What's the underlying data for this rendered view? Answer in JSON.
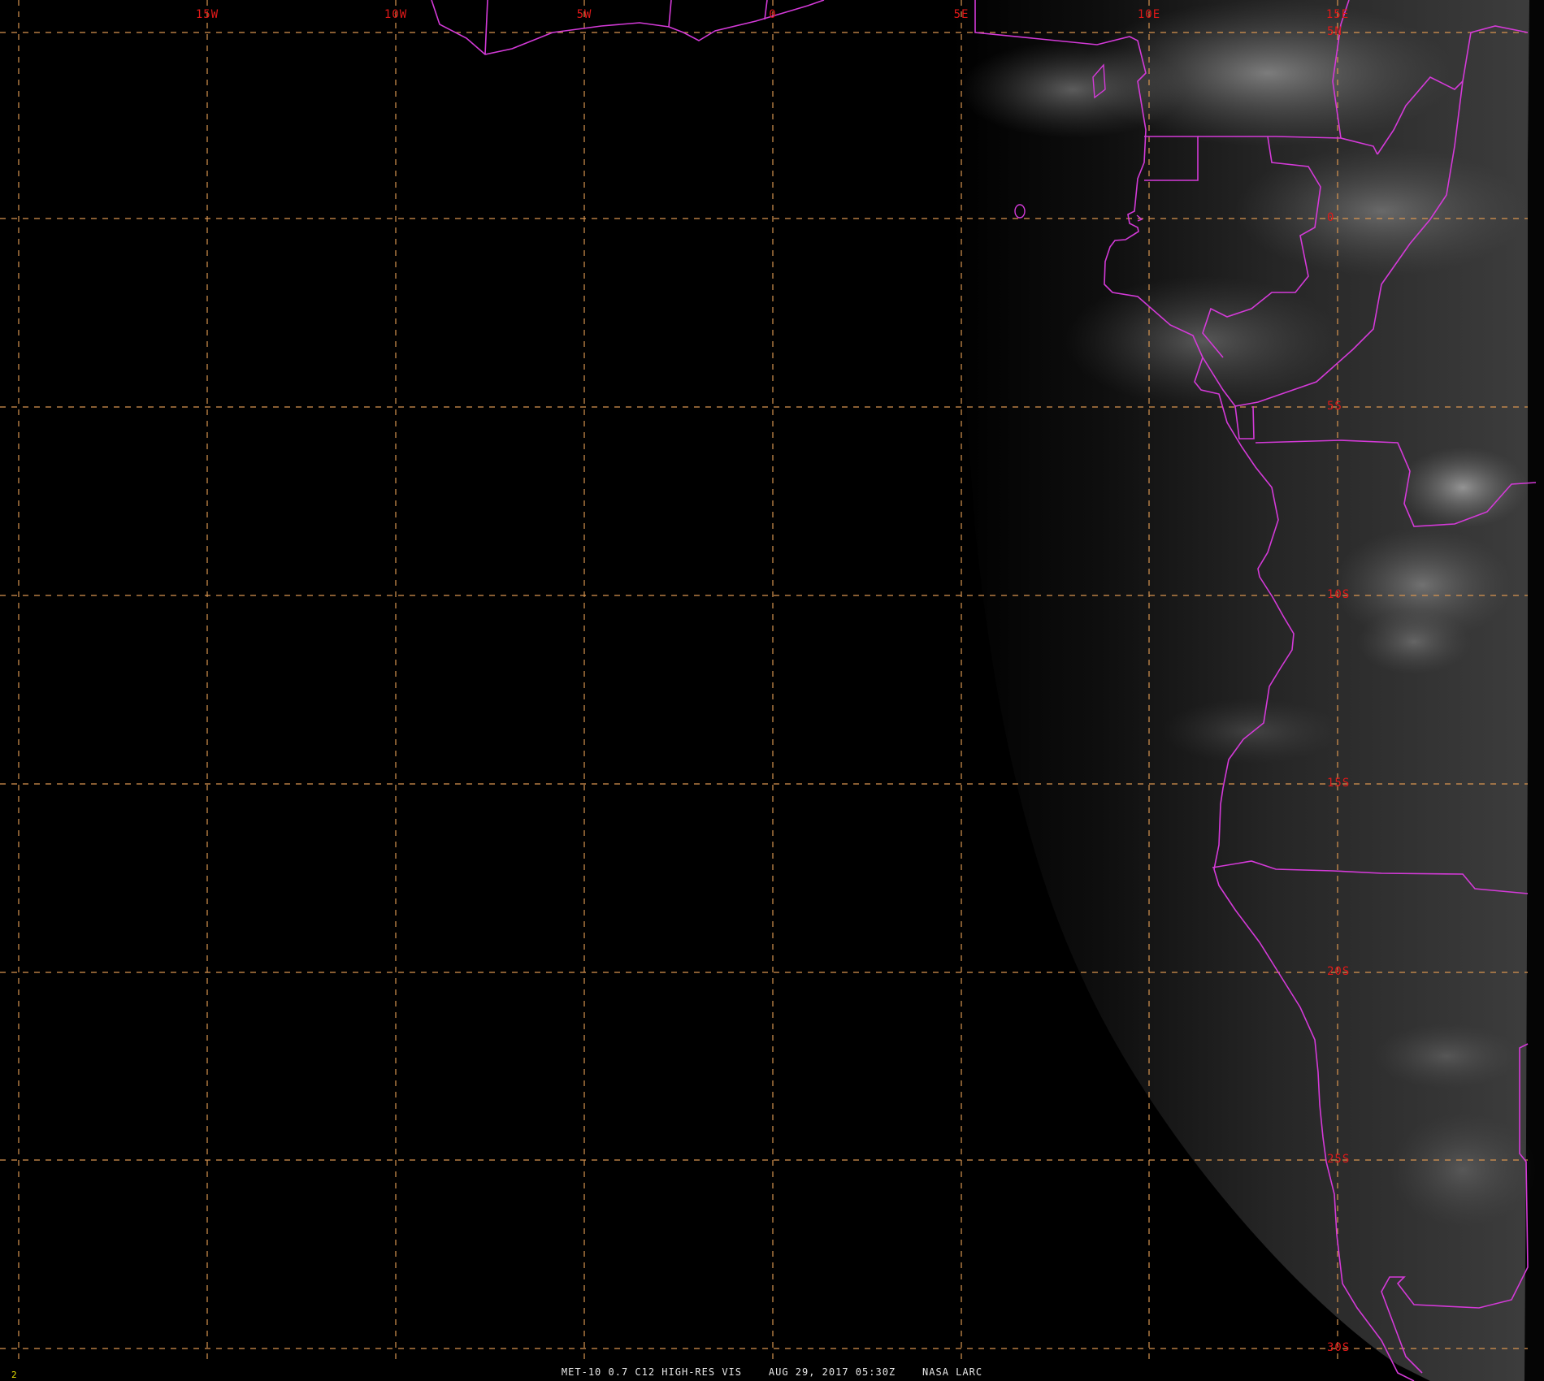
{
  "lon_labels": [
    "15W",
    "10W",
    "5W",
    "0",
    "5E",
    "10E",
    "15E"
  ],
  "lat_labels": [
    "5N",
    "0",
    "5S",
    "10S",
    "15S",
    "20S",
    "25S",
    "30S"
  ],
  "caption": "MET-10 0.7 C12 HIGH-RES VIS    AUG 29, 2017 05:30Z    NASA LARC",
  "frame_number": "2",
  "colors": {
    "grid": "#d9954f",
    "borders": "#d43ad8",
    "labels": "#e01818",
    "caption": "#e8e8e8",
    "frame_number": "#e8e000"
  }
}
